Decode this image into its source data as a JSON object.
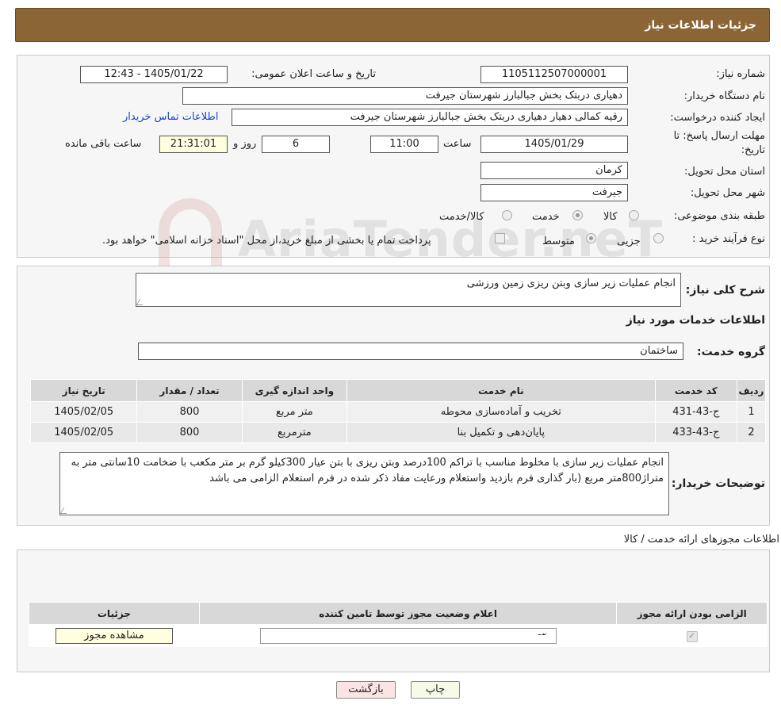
{
  "header": {
    "title": "جزئیات اطلاعات نیاز"
  },
  "form": {
    "need_number_label": "شماره نیاز:",
    "need_number": "1105112507000001",
    "announce_label": "تاریخ و ساعت اعلان عمومی:",
    "announce_value": "1405/01/22 - 12:43",
    "buyer_org_label": "نام دستگاه خریدار:",
    "buyer_org": "دهیاری دربتک بخش جبالبارز شهرستان جیرفت",
    "creator_label": "ایجاد کننده درخواست:",
    "creator": "رقیه کمالی دهیار دهیاری دربتک بخش جبالبارز شهرستان جیرفت",
    "contact_link": "اطلاعات تماس خریدار",
    "deadline_label_1": "مهلت ارسال پاسخ: تا",
    "deadline_label_2": "تاریخ:",
    "deadline_date": "1405/01/29",
    "time_label": "ساعت",
    "deadline_time": "11:00",
    "days_value": "6",
    "days_label": "روز و",
    "remaining_time": "21:31:01",
    "remaining_label": "ساعت باقی مانده",
    "province_label": "استان محل تحویل:",
    "province": "کرمان",
    "city_label": "شهر محل تحویل:",
    "city": "جیرفت",
    "category_label": "طبقه بندی موضوعی:",
    "category_options": [
      "کالا",
      "خدمت",
      "کالا/خدمت"
    ],
    "category_selected": "خدمت",
    "process_label": "نوع فرآیند خرید :",
    "process_options": [
      "جزیی",
      "متوسط"
    ],
    "process_selected": "متوسط",
    "process_note": "پرداخت تمام یا بخشی از مبلغ خرید،از محل \"اسناد خزانه اسلامی\" خواهد بود."
  },
  "watermark": "AriaTender.neT",
  "details": {
    "summary_label": "شرح کلی نیاز:",
    "summary": "انجام عملیات زیر سازی وبتن ریزی زمین ورزشی",
    "services_heading": "اطلاعات خدمات مورد نیاز",
    "group_label": "گروه خدمت:",
    "group_value": "ساختمان",
    "table_headers": [
      "ردیف",
      "کد خدمت",
      "نام خدمت",
      "واحد اندازه گیری",
      "تعداد / مقدار",
      "تاریخ نیاز"
    ],
    "rows": [
      [
        "1",
        "ج-43-431",
        "تخریب و آماده‌سازی محوطه",
        "متر مربع",
        "800",
        "1405/02/05"
      ],
      [
        "2",
        "ج-43-433",
        "پایان‌دهی و تکمیل بنا",
        "مترمربع",
        "800",
        "1405/02/05"
      ]
    ],
    "buyer_notes_label": "توضیحات خریدار:",
    "buyer_notes": "انجام عملیات زیر سازی با مخلوط مناسب با تراکم 100درصد وبتن ریزی با بتن عیار 300کیلو گرم بر متر مکعب با ضخامت 10سانتی متر به متراژ800متر مربع (بار گذاری فرم بازدید واستعلام ورعایت مفاد ذکر شده در فرم استعلام الزامی می باشد"
  },
  "permits": {
    "heading": "اطلاعات مجوزهای ارائه خدمت / کالا",
    "headers": [
      "الزامی بودن ارائه مجوز",
      "اعلام وضعیت مجوز توسط تامین کننده",
      "جزئیات"
    ],
    "select_value": "--",
    "view_button": "مشاهده مجوز"
  },
  "actions": {
    "print": "چاپ",
    "back": "بازگشت"
  }
}
